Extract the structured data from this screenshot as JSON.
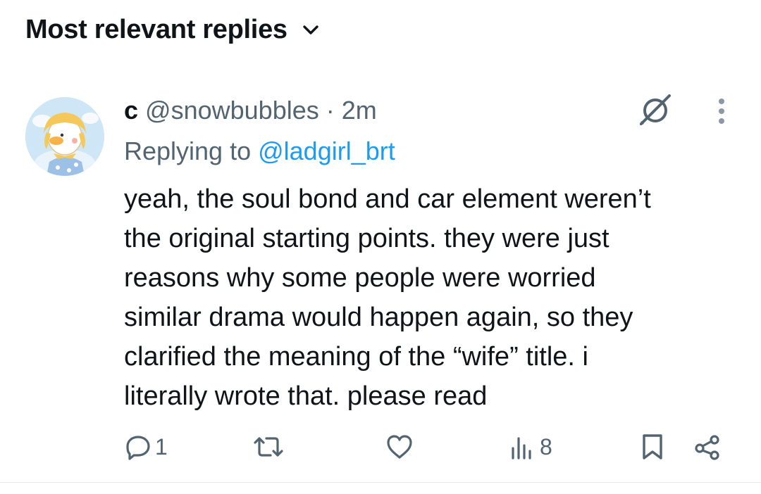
{
  "header": {
    "sort_label": "Most relevant replies",
    "chevron_icon": "chevron-down-icon"
  },
  "reply": {
    "display_name": "c",
    "handle": "@snowbubbles",
    "separator": " · ",
    "timestamp": "2m",
    "replying_prefix": "Replying to ",
    "replying_to": "@ladgirl_brt",
    "text": "yeah, the soul bond and car element weren’t\nthe original starting points. they were just\nreasons why some people were worried\nsimilar drama would happen again, so they\nclarified the meaning of the “wife” title.  i\nliterally wrote that. please read",
    "avatar_icon": "duck-avatar",
    "grok_icon": "grok-icon",
    "more_icon": "more-vertical-icon"
  },
  "actions": {
    "reply_count": "1",
    "repost_count": "",
    "like_count": "",
    "views_count": "8",
    "icons": [
      "reply-icon",
      "repost-icon",
      "like-icon",
      "views-icon",
      "bookmark-icon",
      "share-icon"
    ]
  },
  "colors": {
    "text_primary": "#0f1419",
    "text_secondary": "#536471",
    "link": "#1d9bf0",
    "divider": "#e7e9ea"
  }
}
